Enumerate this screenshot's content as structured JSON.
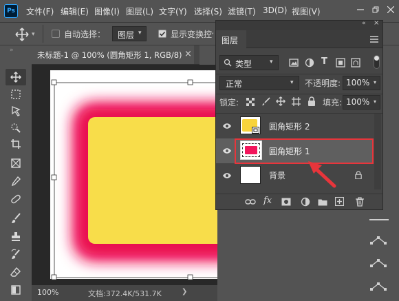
{
  "app": {
    "logo_text": "Ps"
  },
  "menu": [
    "文件(F)",
    "编辑(E)",
    "图像(I)",
    "图层(L)",
    "文字(Y)",
    "选择(S)",
    "滤镜(T)",
    "3D(D)",
    "视图(V)"
  ],
  "options": {
    "auto_select_label": "自动选择：",
    "auto_select_value": "图层",
    "show_transform_label": "显示变换控件"
  },
  "document": {
    "tab_title": "未标题-1 @ 100% (圆角矩形 1, RGB/8) *",
    "close_glyph": "×",
    "zoom": "100%",
    "doc_info": "文档:372.4K/531.7K"
  },
  "layers_panel": {
    "title": "图层",
    "filter_label": "类型",
    "blend_mode": "正常",
    "opacity_label": "不透明度:",
    "opacity_value": "100%",
    "lock_label": "锁定:",
    "fill_label": "填充:",
    "fill_value": "100%",
    "layers": [
      {
        "name": "圆角矩形 2",
        "selected": false,
        "thumb_color": "#f8d33c"
      },
      {
        "name": "圆角矩形 1",
        "selected": true,
        "thumb_color": "#f2165c"
      },
      {
        "name": "背景",
        "selected": false,
        "thumb_color": "#ffffff"
      }
    ]
  },
  "colors": {
    "app_bg": "#535353",
    "panel_bg": "#454545",
    "selected_row": "#5f5f5f",
    "annotation_red": "#e8353b",
    "glow_pink": "#f2165c",
    "card_yellow": "#f8dd4a",
    "accent_blue": "#31a8ff"
  }
}
